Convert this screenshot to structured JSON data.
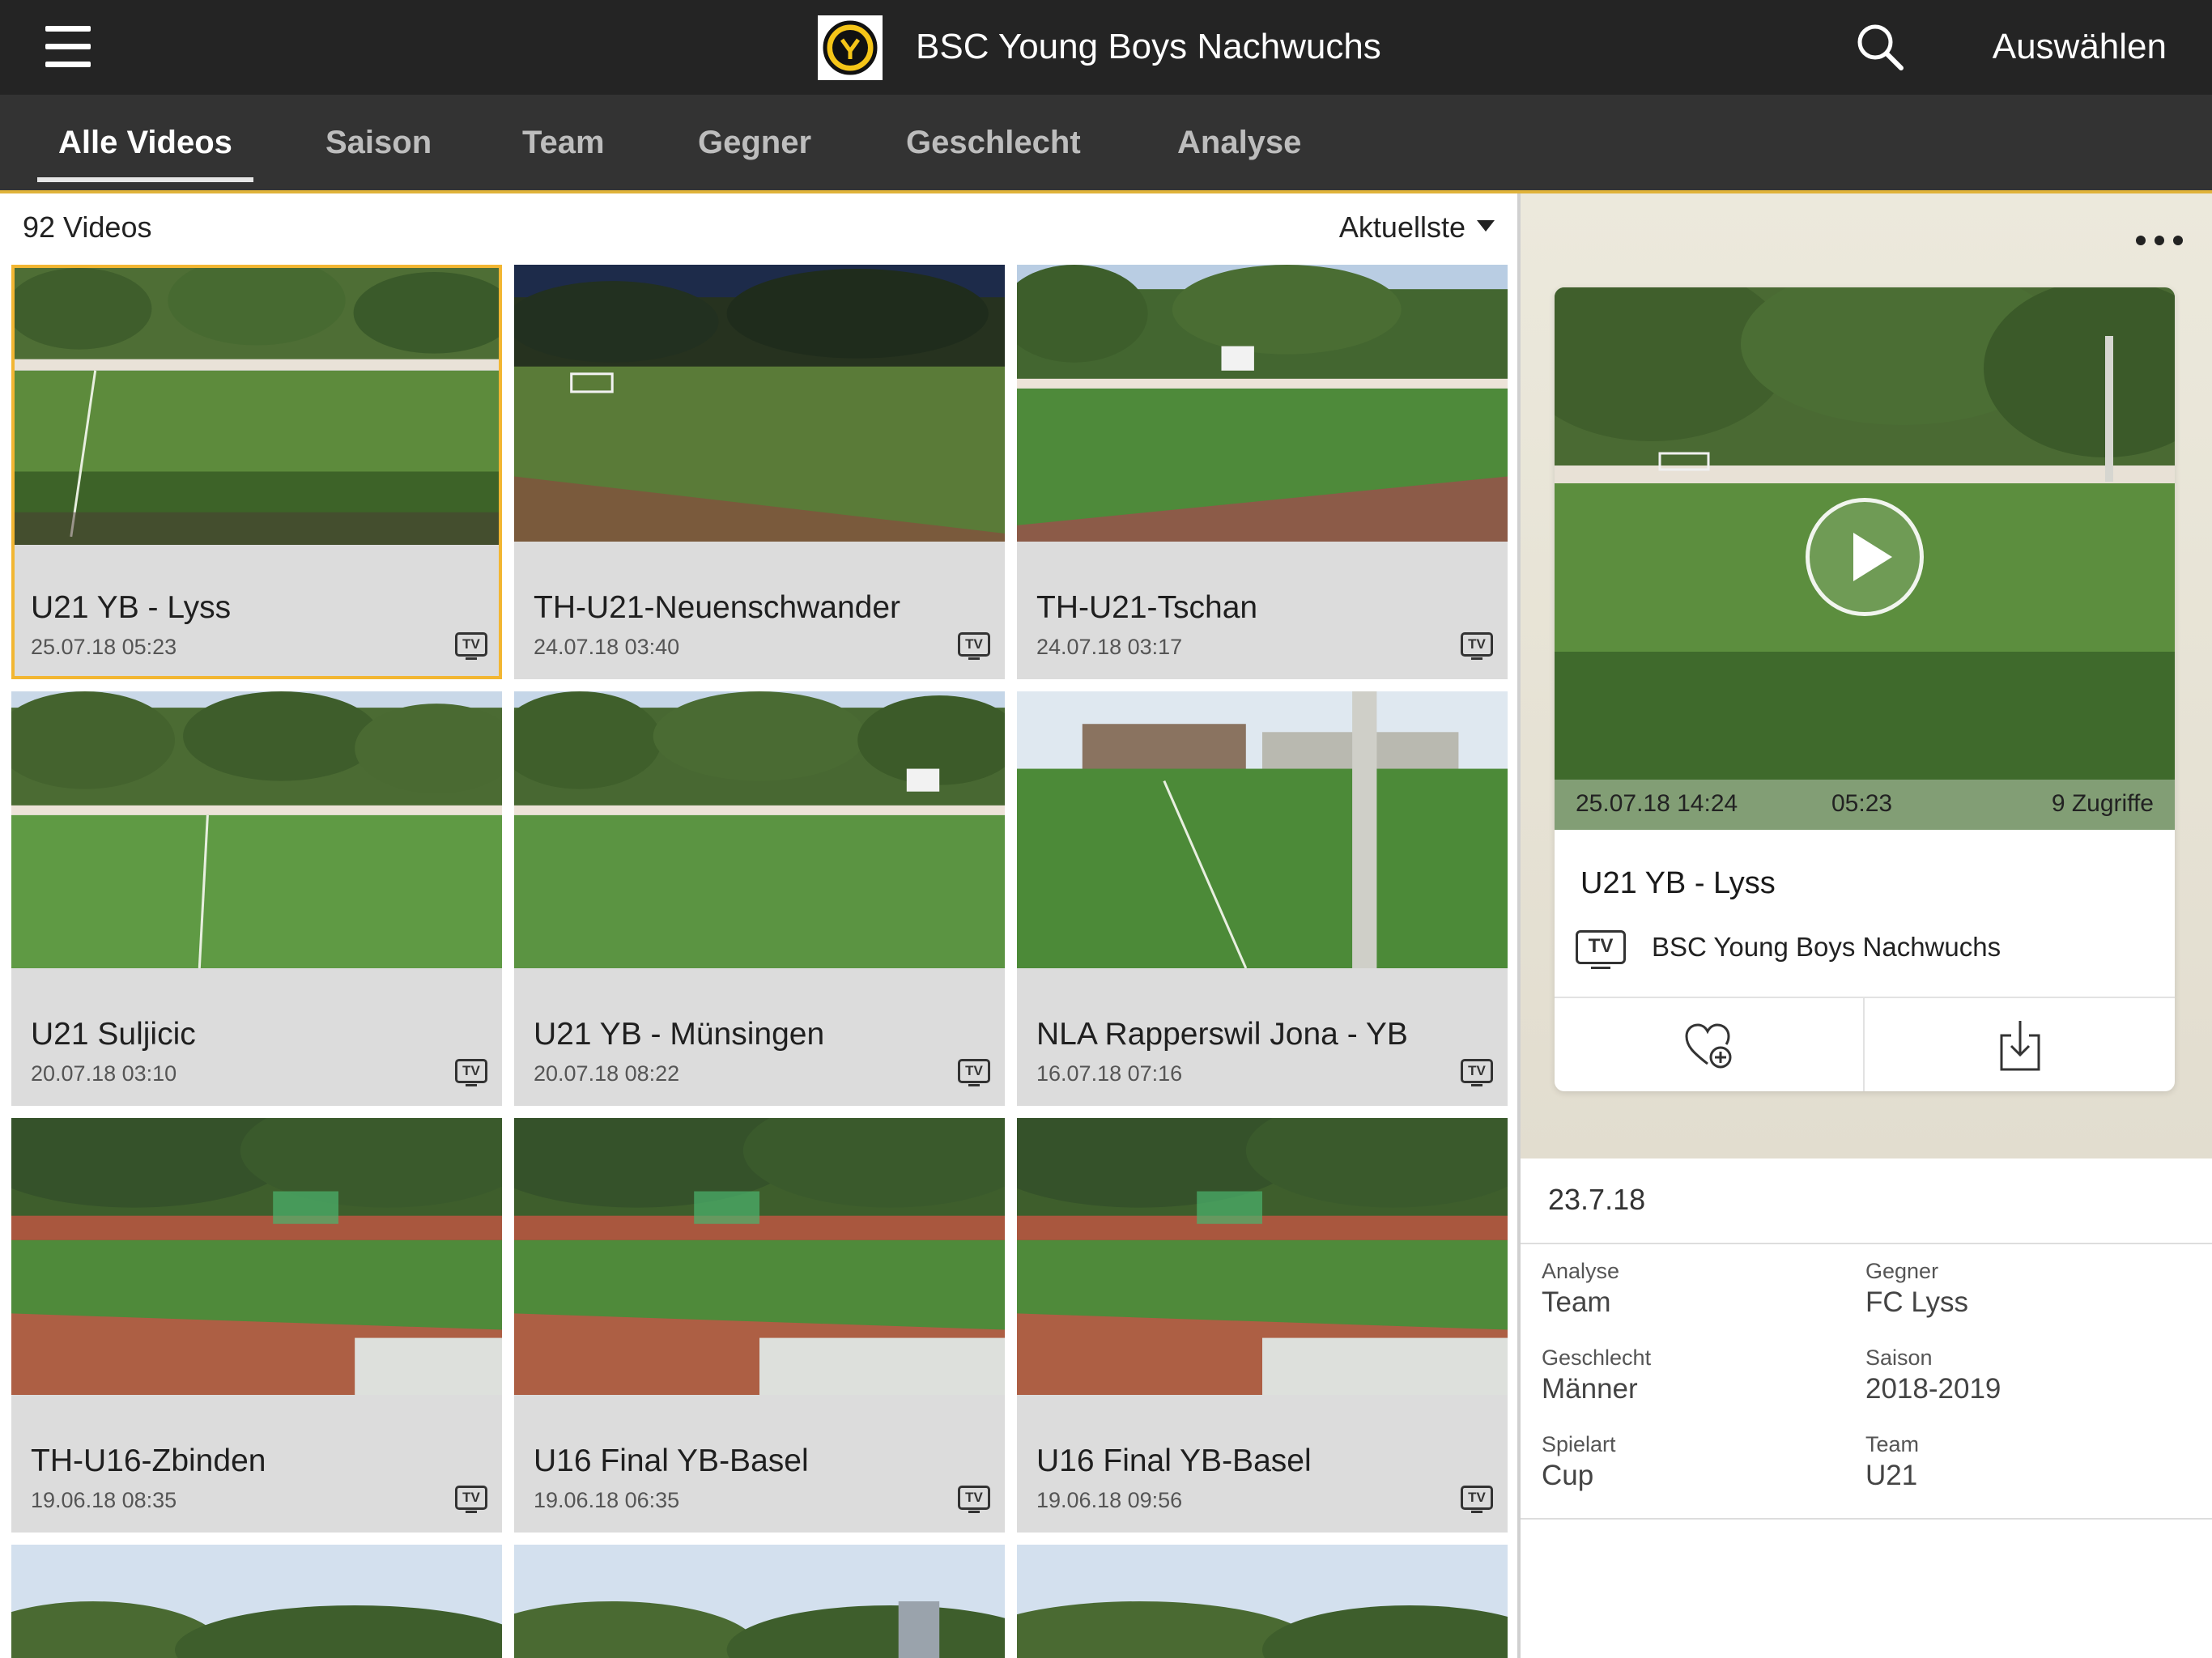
{
  "header": {
    "title": "BSC Young Boys Nachwuchs",
    "select_label": "Auswählen",
    "menu_icon": "hamburger-menu-icon",
    "search_icon": "search-icon",
    "accent_color": "#f2b632"
  },
  "tabs": [
    {
      "label": "Alle Videos",
      "active": true
    },
    {
      "label": "Saison",
      "active": false
    },
    {
      "label": "Team",
      "active": false
    },
    {
      "label": "Gegner",
      "active": false
    },
    {
      "label": "Geschlecht",
      "active": false
    },
    {
      "label": "Analyse",
      "active": false
    }
  ],
  "list": {
    "count_label": "92 Videos",
    "sort_label": "Aktuellste",
    "videos": [
      {
        "title": "U21 YB - Lyss",
        "date": "25.07.18 05:23",
        "badge": "TV",
        "selected": true
      },
      {
        "title": "TH-U21-Neuenschwander",
        "date": "24.07.18 03:40",
        "badge": "TV",
        "selected": false
      },
      {
        "title": "TH-U21-Tschan",
        "date": "24.07.18 03:17",
        "badge": "TV",
        "selected": false
      },
      {
        "title": "U21 Suljicic",
        "date": "20.07.18 03:10",
        "badge": "TV",
        "selected": false
      },
      {
        "title": "U21 YB - Münsingen",
        "date": "20.07.18 08:22",
        "badge": "TV",
        "selected": false
      },
      {
        "title": "NLA Rapperswil Jona - YB",
        "date": "16.07.18 07:16",
        "badge": "TV",
        "selected": false
      },
      {
        "title": "TH-U16-Zbinden",
        "date": "19.06.18 08:35",
        "badge": "TV",
        "selected": false
      },
      {
        "title": "U16 Final YB-Basel",
        "date": "19.06.18 06:35",
        "badge": "TV",
        "selected": false
      },
      {
        "title": "U16 Final YB-Basel",
        "date": "19.06.18 09:56",
        "badge": "TV",
        "selected": false
      }
    ]
  },
  "detail": {
    "more_icon": "more-options-icon",
    "date_time": "25.07.18 14:24",
    "duration": "05:23",
    "views": "9 Zugriffe",
    "title": "U21 YB - Lyss",
    "channel_badge": "TV",
    "channel": "BSC Young Boys Nachwuchs",
    "favorite_icon": "heart-add-icon",
    "download_icon": "download-icon",
    "recorded_date": "23.7.18",
    "info": [
      {
        "label": "Analyse",
        "value": "Team"
      },
      {
        "label": "Gegner",
        "value": "FC Lyss"
      },
      {
        "label": "Geschlecht",
        "value": "Männer"
      },
      {
        "label": "Saison",
        "value": "2018-2019"
      },
      {
        "label": "Spielart",
        "value": "Cup"
      },
      {
        "label": "Team",
        "value": "U21"
      }
    ]
  }
}
